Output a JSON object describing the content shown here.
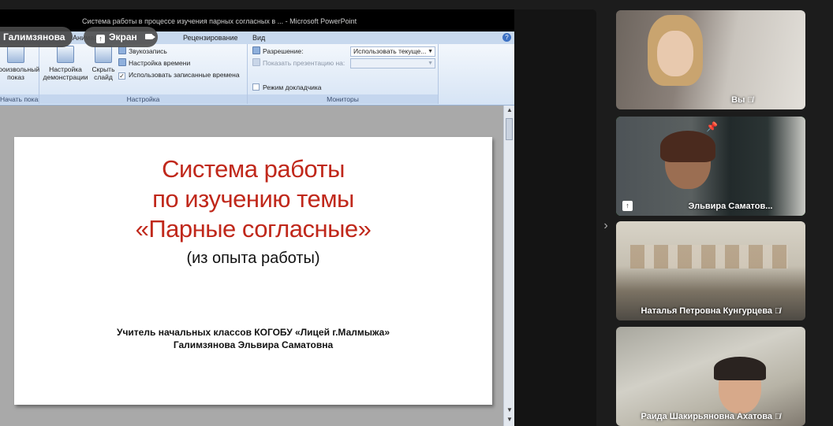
{
  "ppt": {
    "title_bar": "Система работы в процессе изучения парных согласных в ... - Microsoft PowerPoint",
    "tabs": [
      "Анимация",
      "Рецензирование",
      "Вид"
    ],
    "help_icon": "?",
    "groups": {
      "start": {
        "btn_label": "Произвольный показ",
        "label": "Начать показ слайдов"
      },
      "setup": {
        "btn_setup": "Настройка демонстрации",
        "btn_hide": "Скрыть слайд",
        "row_record": "Звукозапись",
        "row_timing": "Настройка времени",
        "row_use_timing": "Использовать записанные времена",
        "label": "Настройка"
      },
      "monitors": {
        "resolution_label": "Разрешение:",
        "resolution_value": "Использовать текуще...",
        "show_on_label": "Показать презентацию на:",
        "show_on_value": "",
        "presenter_mode": "Режим докладчика",
        "label": "Мониторы"
      }
    }
  },
  "slide": {
    "title_line1": "Система работы",
    "title_line2": "по изучению темы",
    "title_line3": "«Парные согласные»",
    "subtitle": "(из опыта работы)",
    "author_line1": "Учитель начальных классов КОГОБУ «Лицей г.Малмыжа»",
    "author_line2": "Галимзянова Эльвира Саматовна"
  },
  "overlay": {
    "presenter_name": "Галимзянова",
    "screen_label": "Экран"
  },
  "participants": [
    {
      "name": "Вы",
      "muted": true
    },
    {
      "name": "Эльвира Саматов...",
      "muted": false,
      "active": true,
      "pinned": true,
      "sharing": true
    },
    {
      "name": "Наталья Петровна Кунгурцева",
      "muted": true
    },
    {
      "name": "Раида Шакирьяновна Ахатова",
      "muted": true
    }
  ],
  "colors": {
    "slide_title": "#c0281b",
    "active_outline": "#3ccf4e",
    "ribbon": "#d6e4f5"
  }
}
